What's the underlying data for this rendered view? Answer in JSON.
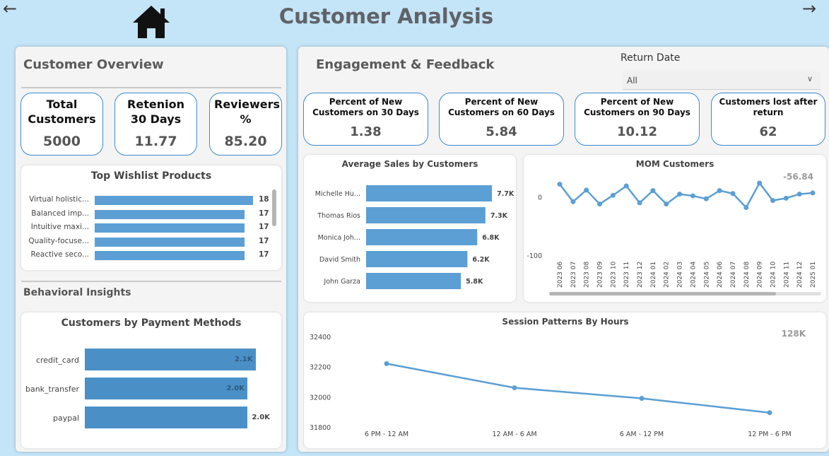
{
  "header": {
    "title": "Customer Analysis",
    "back_icon": "arrow-left-icon",
    "forward_icon": "arrow-right-icon",
    "home_icon": "home-icon"
  },
  "overview": {
    "title": "Customer Overview",
    "cards": [
      {
        "label": "Total Customers",
        "value": "5000"
      },
      {
        "label": "Retenion 30 Days",
        "value": "11.77"
      },
      {
        "label": "Reviewers %",
        "value": "85.20"
      }
    ]
  },
  "wishlist": {
    "title": "Top Wishlist Products",
    "items": [
      {
        "label": "Virtual holistic...",
        "value": 18
      },
      {
        "label": "Balanced imp...",
        "value": 17
      },
      {
        "label": "Intuitive maxi...",
        "value": 17
      },
      {
        "label": "Quality-focuse...",
        "value": 17
      },
      {
        "label": "Reactive seco...",
        "value": 17
      }
    ]
  },
  "behavioral": {
    "title": "Behavioral Insights"
  },
  "payments": {
    "title": "Customers by Payment Methods",
    "items": [
      {
        "label": "credit_card",
        "value": 2100,
        "value_label": "2.1K"
      },
      {
        "label": "bank_transfer",
        "value": 2000,
        "value_label": "2.0K"
      },
      {
        "label": "paypal",
        "value": 2000,
        "value_label": "2.0K"
      }
    ]
  },
  "engagement": {
    "title": "Engagement & Feedback",
    "filter": {
      "label": "Return Date",
      "selected": "All"
    },
    "cards": [
      {
        "label": "Percent of New Customers on 30 Days",
        "value": "1.38"
      },
      {
        "label": "Percent of New Customers on 60 Days",
        "value": "5.84"
      },
      {
        "label": "Percent of New Customers on 90 Days",
        "value": "10.12"
      },
      {
        "label": "Customers lost after return",
        "value": "62"
      }
    ]
  },
  "colors": {
    "bar": "#5b9fd4",
    "payment_bar": "#4a90c6",
    "line": "#5b9fd4",
    "card_border": "#3b8bd4",
    "background": "#c4e4f7"
  },
  "chart_data": [
    {
      "type": "bar",
      "orientation": "horizontal",
      "title": "Average Sales by Customers",
      "categories": [
        "Michelle Hu...",
        "Thomas Rios",
        "Monica Joh...",
        "David Smith",
        "John Garza"
      ],
      "values": [
        7700,
        7300,
        6800,
        6200,
        5800
      ],
      "value_labels": [
        "7.7K",
        "7.3K",
        "6.8K",
        "6.2K",
        "5.8K"
      ]
    },
    {
      "type": "line",
      "title": "MOM Customers",
      "annotation": "-56.84",
      "x": [
        "2023 06",
        "2023 07",
        "2023 08",
        "2023 09",
        "2023 10",
        "2023 11",
        "2023 12",
        "2024 01",
        "2024 02",
        "2024 03",
        "2024 04",
        "2024 05",
        "2024 06",
        "2024 07",
        "2024 08",
        "2024 09",
        "2024 10",
        "2024 11",
        "2024 12",
        "2025 01"
      ],
      "y": [
        22,
        -8,
        12,
        -12,
        3,
        19,
        -10,
        11,
        -12,
        5,
        2,
        -3,
        11,
        6,
        -18,
        24,
        -6,
        -2,
        5,
        7
      ],
      "yticks": [
        "0",
        "-100"
      ],
      "ylim": [
        -100,
        30
      ]
    },
    {
      "type": "line",
      "title": "Session Patterns By Hours",
      "annotation": "128K",
      "categories": [
        "6 PM - 12 AM",
        "12 AM - 6 AM",
        "6 AM - 12 PM",
        "12 PM - 6 PM"
      ],
      "values": [
        32220,
        32060,
        31990,
        31895
      ],
      "yticks": [
        "32400",
        "32200",
        "32000",
        "31800"
      ],
      "ylim": [
        31800,
        32400
      ]
    }
  ]
}
